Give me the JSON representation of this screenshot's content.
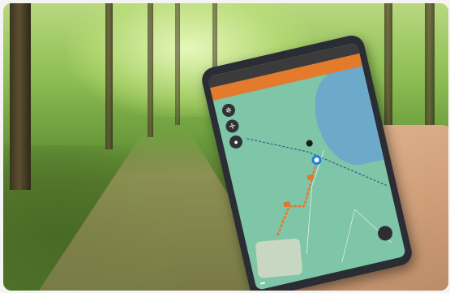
{
  "scene": {
    "description_tags": [
      "forest-path",
      "hand",
      "smartphone",
      "map-app"
    ]
  },
  "phone": {
    "url_bar": "",
    "toolbar": {
      "left_label": "",
      "right_label": ""
    },
    "map": {
      "scale_label": "",
      "controls": [
        "compass-icon",
        "center-icon",
        "marker-icon"
      ]
    }
  },
  "colors": {
    "toolbar_orange": "#e47a2c",
    "route_orange": "#e8742a",
    "location_blue": "#1e7fe0",
    "map_green": "#7fc5a7",
    "water_blue": "#6aa3cf"
  }
}
